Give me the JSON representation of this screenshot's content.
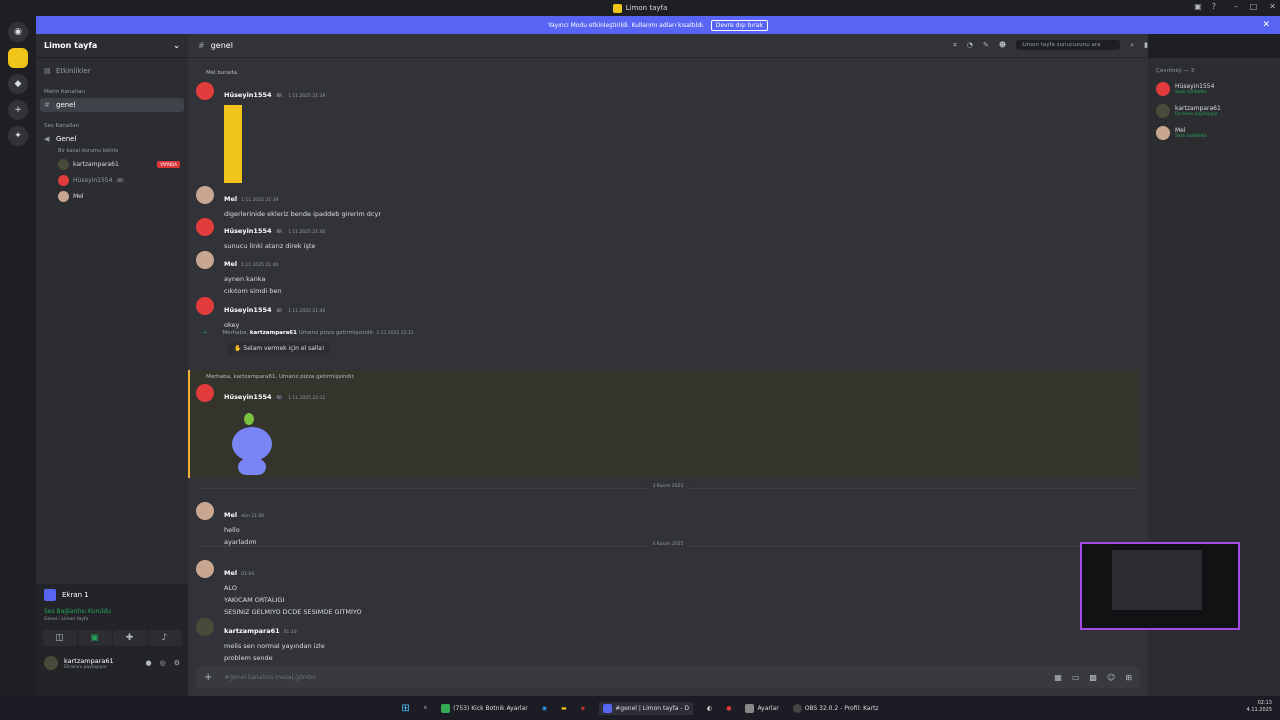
{
  "window": {
    "title": "Limon tayfa"
  },
  "banner": {
    "text": "Yayıncı Modu etkinleştirildi. Kullanmı adları kısaltıldı.",
    "button": "Devre dışı bırak",
    "close": "✕"
  },
  "sidebar": {
    "guild_name": "Limon tayfa",
    "events": "Etkinlikler",
    "text_category": "Metin Kanalları",
    "text_channel": "genel",
    "voice_category": "Ses Kanalları",
    "voice_channel": "Genel",
    "voice_status": "Bir kanal durumu belirle",
    "voice_users": [
      {
        "name": "kartzampara61",
        "badge": "YAYINDA"
      },
      {
        "name": "Hüseyin1554",
        "badge": "RR"
      },
      {
        "name": "Mel",
        "badge": ""
      }
    ]
  },
  "userpanel": {
    "screen": "Ekran 1",
    "voice_connected": "Ses Bağlantısı Kuruldu",
    "voice_location": "Genel / Limon tayfa",
    "username": "kartzampara61",
    "user_status": "Ekranını paylaşıyor"
  },
  "header": {
    "channel": "genel",
    "search_placeholder": "Limon tayfa sunucusunu ara"
  },
  "messages": [
    {
      "reply": "Mel burada.",
      "author": "Hüseyin1554",
      "badge": "RR",
      "time": "1.11.2025 21:39",
      "text": ""
    },
    {
      "author": "Mel",
      "time": "1.11.2025 21:39",
      "text": "digerlerinide ekleriz bende ipaddeb girerim dcyr"
    },
    {
      "author": "Hüseyin1554",
      "badge": "RR",
      "time": "1.11.2025 21:40",
      "text": "sunucu linki atarız direk işte"
    },
    {
      "author": "Mel",
      "time": "1.11.2025 21:40",
      "text": "aynen kanka",
      "text2": "cıkıtom simdi ben"
    },
    {
      "author": "Hüseyin1554",
      "badge": "RR",
      "time": "1.11.2025 21:40",
      "text": "okey"
    },
    {
      "system_prefix": "Merhaba,",
      "system_user": "kartzampara61",
      "system_suffix": "Umarız pizza getirmişsindir.",
      "time": "1.11.2025 22:12",
      "wave": "Selam vermek için el salla!"
    },
    {
      "reply": "Merhaba, kartzampara61. Umarız pizza getirmişsindir.",
      "author": "Hüseyin1554",
      "badge": "RR",
      "time": "1.11.2025 22:12",
      "text": ""
    },
    {
      "author": "Mel",
      "time": "dün 21:00",
      "text": "hello",
      "text2": "ayarladım"
    },
    {
      "author": "Mel",
      "time": "01:04",
      "text": "ALO",
      "text2": "YAKICAM ORTALIGI",
      "text3": "SESINIZ GELMIYO DCDE SESIMDE GITMIYO"
    },
    {
      "author": "kartzampara61",
      "time": "01:10",
      "text": "melis sen normal yayından izle",
      "text2": "problem sende"
    }
  ],
  "dividers": [
    "3 Kasım 2025",
    "4 Kasım 2025"
  ],
  "input": {
    "placeholder": "#genel kanalına mesaj gönder"
  },
  "members": {
    "heading": "Çevrimiçi — 3",
    "list": [
      {
        "name": "Hüseyin1554",
        "status": "Sesli sohbette"
      },
      {
        "name": "kartzampara61",
        "status": "Ekranını paylaşıyor"
      },
      {
        "name": "Mel",
        "status": "Sesli sohbette"
      }
    ]
  },
  "taskbar": {
    "items": [
      "(753) Kick Botnik Ayarlar",
      "#genel | Limon tayfa - D",
      "Ayarlar",
      "OBS 32.0.2 - Profil: Kartz"
    ],
    "time": "02:13",
    "date": "4.11.2025"
  },
  "colors": {
    "accent": "#5865f2",
    "live": "#da373c",
    "online": "#23a55a"
  }
}
